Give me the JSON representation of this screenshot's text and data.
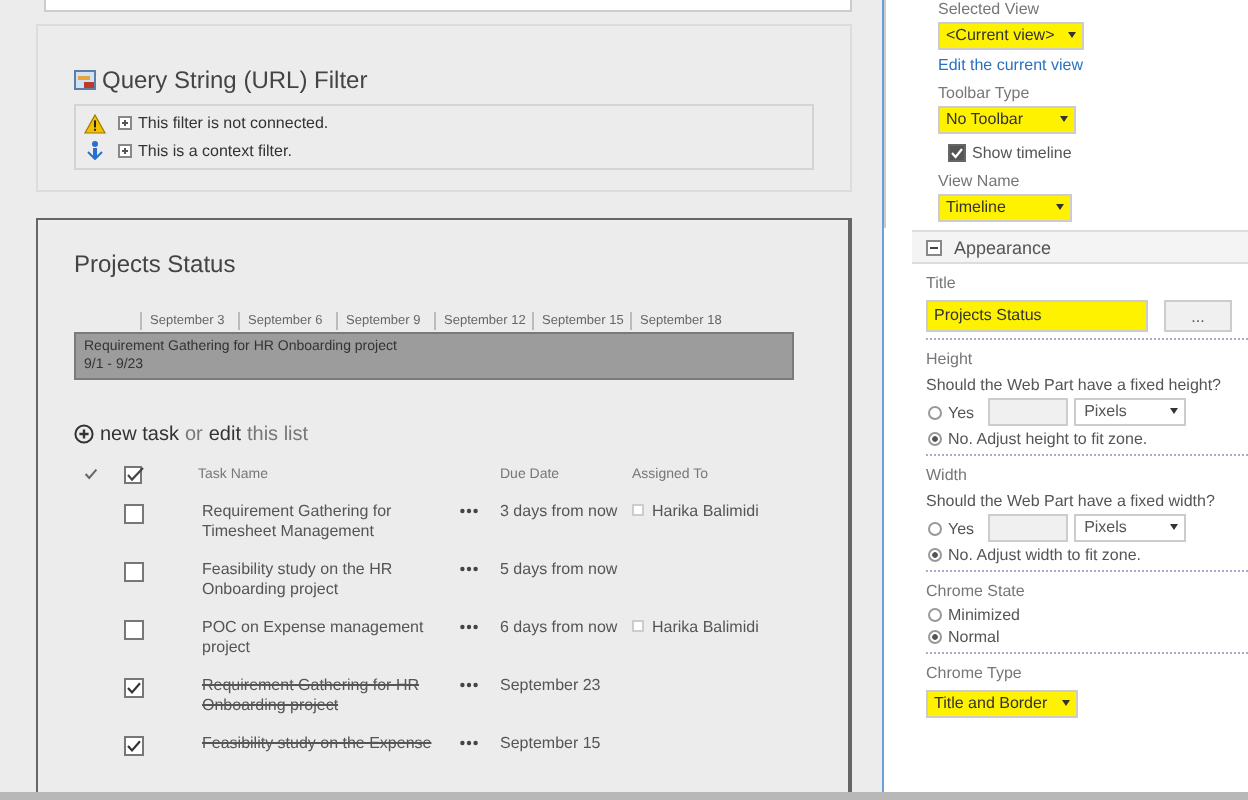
{
  "filter_part": {
    "title": "Query String (URL) Filter",
    "messages": [
      {
        "kind": "warning",
        "text": "This filter is not connected."
      },
      {
        "kind": "info",
        "text": "This is a context filter."
      }
    ]
  },
  "tasks_part": {
    "title": "Projects Status",
    "timeline": {
      "dates": [
        "September 3",
        "September 6",
        "September 9",
        "September 12",
        "September 15",
        "September 18"
      ],
      "bar_name": "Requirement Gathering for HR Onboarding project",
      "bar_range": "9/1 - 9/23"
    },
    "actions": {
      "new_task": "new task",
      "or": "or",
      "edit": "edit",
      "this_list": "this list"
    },
    "columns": [
      "Task Name",
      "Due Date",
      "Assigned To"
    ],
    "rows": [
      {
        "name": "Requirement Gathering for Timesheet Management",
        "completed": false,
        "due": "3 days from now",
        "assigned": "Harika Balimidi"
      },
      {
        "name": "Feasibility study on the HR Onboarding project",
        "completed": false,
        "due": "5 days from now"
      },
      {
        "name": "POC on Expense management project",
        "completed": false,
        "due": "6 days from now",
        "assigned": "Harika Balimidi"
      },
      {
        "name": "Requirement Gathering for HR Onboarding project",
        "completed": true,
        "due": "September 23"
      },
      {
        "name": "Feasibility study on the Expense",
        "completed": true,
        "due": "September 15"
      }
    ]
  },
  "tool_pane": {
    "view_settings": [
      {
        "kind": "dropdown",
        "label": "Selected View",
        "value": "<Current view>",
        "highlighted": true
      },
      {
        "kind": "link",
        "text": "Edit the current view"
      },
      {
        "kind": "dropdown",
        "label": "Toolbar Type",
        "value": "No Toolbar",
        "highlighted": true
      },
      {
        "kind": "checkbox",
        "text": "Show timeline",
        "checked": true
      },
      {
        "kind": "dropdown",
        "label": "View Name",
        "value": "Timeline",
        "highlighted": true
      }
    ],
    "section": {
      "title": "Appearance",
      "expanded": true
    },
    "groups": [
      {
        "label": "Title",
        "controls": [
          {
            "kind": "text_button",
            "value": "Projects Status",
            "button": "...",
            "highlighted": true
          }
        ]
      },
      {
        "label": "Height",
        "controls": [
          {
            "kind": "question",
            "text": "Should the Web Part have a fixed height?"
          },
          {
            "kind": "size_radio",
            "text": "Yes",
            "selected": false,
            "unit": "Pixels"
          },
          {
            "kind": "radio",
            "text": "No. Adjust height to fit zone.",
            "selected": true
          }
        ]
      },
      {
        "label": "Width",
        "controls": [
          {
            "kind": "question",
            "text": "Should the Web Part have a fixed width?"
          },
          {
            "kind": "size_radio",
            "text": "Yes",
            "selected": false,
            "unit": "Pixels"
          },
          {
            "kind": "radio",
            "text": "No. Adjust width to fit zone.",
            "selected": true
          }
        ]
      },
      {
        "label": "Chrome State",
        "controls": [
          {
            "kind": "radio",
            "text": "Minimized",
            "selected": false
          },
          {
            "kind": "radio",
            "text": "Normal",
            "selected": true
          }
        ]
      },
      {
        "label": "Chrome Type",
        "controls": [
          {
            "kind": "dropdown",
            "value": "Title and Border",
            "highlighted": true
          }
        ]
      }
    ]
  }
}
